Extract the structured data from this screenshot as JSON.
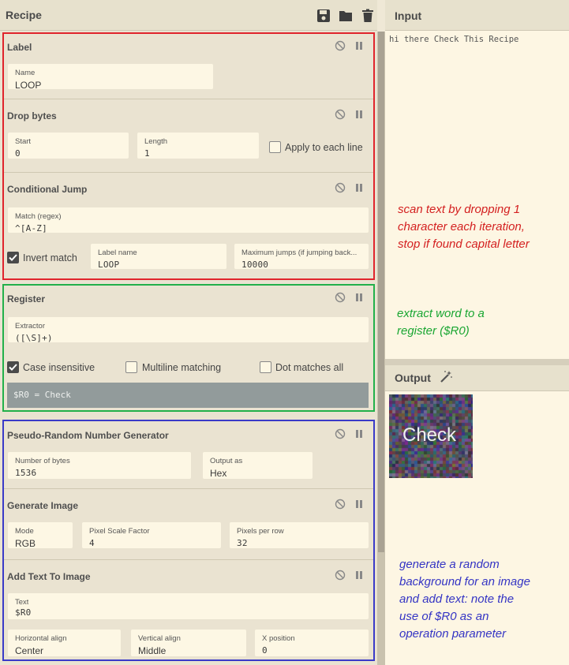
{
  "recipe": {
    "title": "Recipe",
    "header_icons": [
      "save-icon",
      "folder-icon",
      "trash-icon"
    ]
  },
  "operations": {
    "label": {
      "title": "Label",
      "name_label": "Name",
      "name_value": "LOOP"
    },
    "drop_bytes": {
      "title": "Drop bytes",
      "start_label": "Start",
      "start_value": "0",
      "length_label": "Length",
      "length_value": "1",
      "apply_each_line_label": "Apply to each line",
      "apply_each_line_checked": false
    },
    "conditional_jump": {
      "title": "Conditional Jump",
      "match_label": "Match (regex)",
      "match_value": "^[A-Z]",
      "invert_match_label": "Invert match",
      "invert_match_checked": true,
      "label_name_label": "Label name",
      "label_name_value": "LOOP",
      "max_jumps_label": "Maximum jumps (if jumping back...",
      "max_jumps_value": "10000"
    },
    "register": {
      "title": "Register",
      "extractor_label": "Extractor",
      "extractor_value": "([\\S]+)",
      "case_insensitive_label": "Case insensitive",
      "case_insensitive_checked": true,
      "multiline_label": "Multiline matching",
      "multiline_checked": false,
      "dot_all_label": "Dot matches all",
      "dot_all_checked": false,
      "register_output": "$R0 = Check"
    },
    "prng": {
      "title": "Pseudo-Random Number Generator",
      "bytes_label": "Number of bytes",
      "bytes_value": "1536",
      "output_as_label": "Output as",
      "output_as_value": "Hex"
    },
    "generate_image": {
      "title": "Generate Image",
      "mode_label": "Mode",
      "mode_value": "RGB",
      "scale_label": "Pixel Scale Factor",
      "scale_value": "4",
      "per_row_label": "Pixels per row",
      "per_row_value": "32"
    },
    "add_text": {
      "title": "Add Text To Image",
      "text_label": "Text",
      "text_value": "$R0",
      "h_align_label": "Horizontal align",
      "h_align_value": "Center",
      "v_align_label": "Vertical align",
      "v_align_value": "Middle",
      "x_pos_label": "X position",
      "x_pos_value": "0"
    }
  },
  "input": {
    "title": "Input",
    "text": "hi there Check This Recipe"
  },
  "output": {
    "title": "Output",
    "image_text": "Check"
  },
  "annotations": {
    "red": {
      "color": "#d42020",
      "lines": [
        "scan text by dropping 1",
        "character each iteration,",
        "stop if found capital letter"
      ]
    },
    "green": {
      "color": "#1aa632",
      "lines": [
        "extract word to a",
        "register ($R0)"
      ]
    },
    "blue": {
      "color": "#3434c4",
      "lines": [
        "generate a random",
        "background for an image",
        "and add text: note the",
        "use of $R0 as an",
        "operation parameter"
      ]
    }
  },
  "colors": {
    "frame_red": "#e0242c",
    "frame_green": "#22b04a",
    "frame_blue": "#3a3ac8",
    "panel_bg": "#fdf6e3"
  }
}
